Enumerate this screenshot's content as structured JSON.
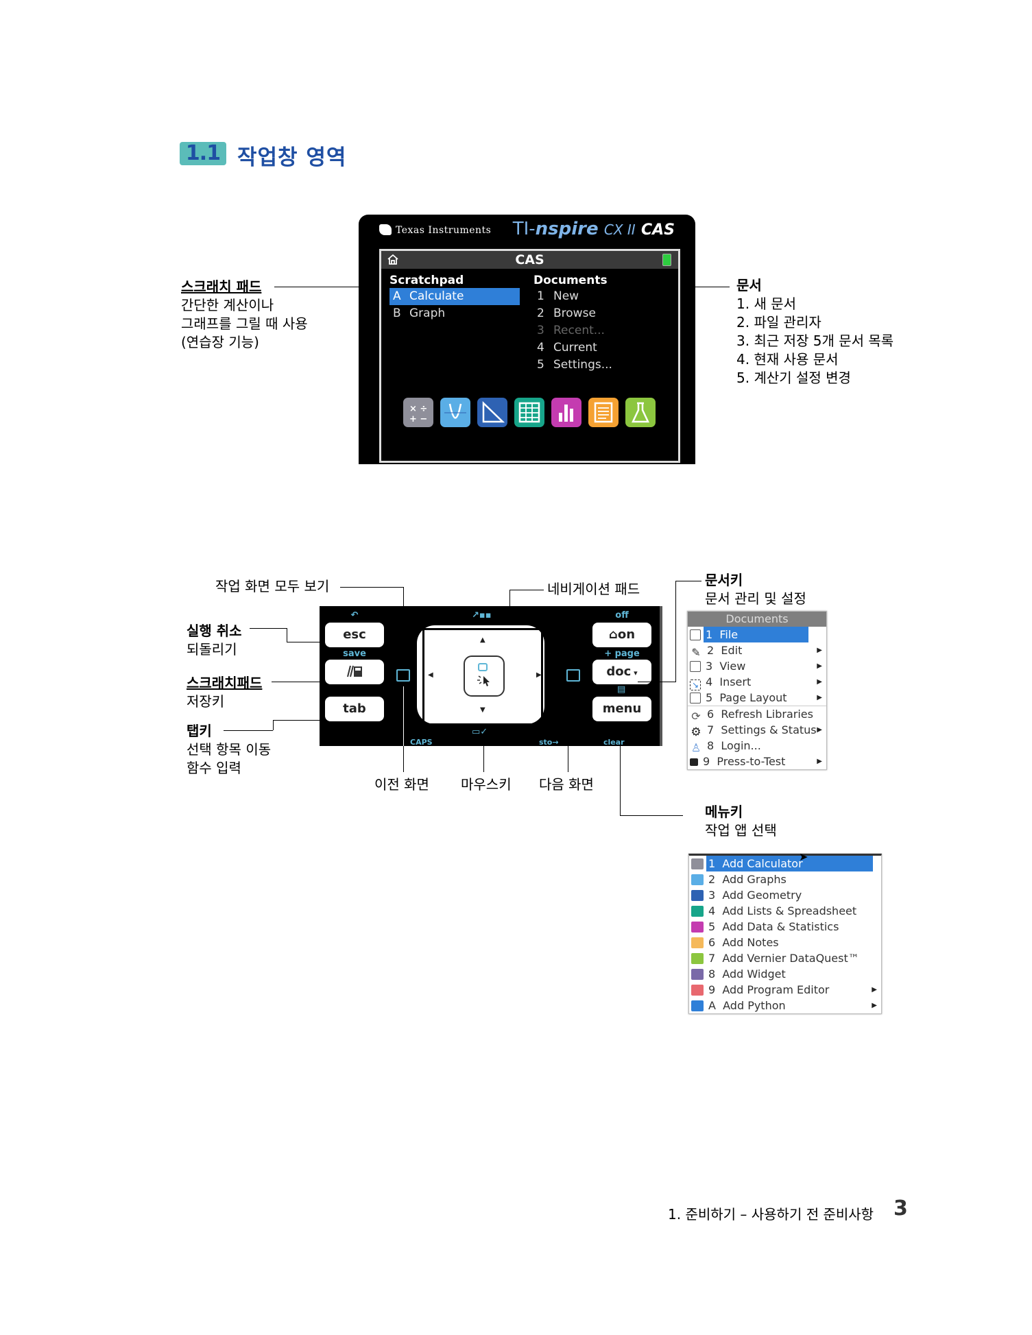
{
  "section": {
    "number": "1.1",
    "title": "작업창 영역"
  },
  "home_screen": {
    "brand": "Texas Instruments",
    "model_prefix": "TI-",
    "model_name": "nspire",
    "model_suffix": "CX II",
    "model_cas": "CAS",
    "header_title": "CAS",
    "scratchpad": {
      "heading": "Scratchpad",
      "items": [
        {
          "key": "A",
          "label": "Calculate",
          "selected": true
        },
        {
          "key": "B",
          "label": "Graph",
          "selected": false
        }
      ]
    },
    "documents": {
      "heading": "Documents",
      "items": [
        {
          "key": "1",
          "label": "New",
          "disabled": false
        },
        {
          "key": "2",
          "label": "Browse",
          "disabled": false
        },
        {
          "key": "3",
          "label": "Recent...",
          "disabled": true
        },
        {
          "key": "4",
          "label": "Current",
          "disabled": false
        },
        {
          "key": "5",
          "label": "Settings...",
          "disabled": false
        }
      ]
    },
    "app_icons": [
      {
        "name": "calculator-app-icon",
        "color": "#8f8f9a"
      },
      {
        "name": "graphs-app-icon",
        "color": "#5aaee6"
      },
      {
        "name": "geometry-app-icon",
        "color": "#2e62b3"
      },
      {
        "name": "lists-spreadsheet-app-icon",
        "color": "#17a58a"
      },
      {
        "name": "data-statistics-app-icon",
        "color": "#c43cb0"
      },
      {
        "name": "notes-app-icon",
        "color": "#f5a132"
      },
      {
        "name": "vernier-dataquest-app-icon",
        "color": "#8cc63f"
      }
    ]
  },
  "annotations_top": {
    "scratchpad": {
      "title": "스크래치 패드",
      "lines": [
        "간단한 계산이나",
        "그래프를 그릴 때 사용",
        "(연습장 기능)"
      ]
    },
    "documents": {
      "title": "문서",
      "lines": [
        "1. 새 문서",
        "2. 파일 관리자",
        "3. 최근 저장 5개 문서 목록",
        "4. 현재 사용 문서",
        "5. 계산기 설정 변경"
      ]
    }
  },
  "keypad": {
    "keys": {
      "esc": "esc",
      "scratchpad": "",
      "tab": "tab",
      "on": "on",
      "doc": "doc",
      "menu": "menu"
    },
    "sublabels": {
      "undo": "↶",
      "save": "save",
      "off": "off",
      "page": "+ page",
      "caps": "CAPS",
      "sto": "sto→",
      "clear": "clear"
    }
  },
  "annotations_bottom": {
    "view_all": "작업 화면 모두 보기",
    "nav_pad": "네비게이션 패드",
    "undo": {
      "title": "실행 취소",
      "line": "되돌리기"
    },
    "scratchpad_key": {
      "title": "스크래치패드",
      "line": "저장키"
    },
    "tab_key": {
      "title": "탭키",
      "lines": [
        "선택 항목 이동",
        "함수 입력"
      ]
    },
    "prev_page": "이전 화면",
    "mouse_key": "마우스키",
    "next_page": "다음 화면",
    "doc_key": {
      "title": "문서키",
      "line": "문서 관리 및 설정"
    },
    "menu_key": {
      "title": "메뉴키",
      "line": "작업 앱 선택"
    }
  },
  "documents_menu": {
    "title": "Documents",
    "items": [
      {
        "key": "1",
        "label": "File",
        "icon": "file-icon",
        "submenu": true,
        "selected": true
      },
      {
        "key": "2",
        "label": "Edit",
        "icon": "pencil-icon",
        "submenu": true
      },
      {
        "key": "3",
        "label": "View",
        "icon": "view-icon",
        "submenu": true
      },
      {
        "key": "4",
        "label": "Insert",
        "icon": "insert-icon",
        "submenu": true
      },
      {
        "key": "5",
        "label": "Page Layout",
        "icon": "page-layout-icon",
        "submenu": true
      },
      {
        "key": "6",
        "label": "Refresh Libraries",
        "icon": "refresh-icon",
        "submenu": false
      },
      {
        "key": "7",
        "label": "Settings & Status",
        "icon": "gear-icon",
        "submenu": true
      },
      {
        "key": "8",
        "label": "Login...",
        "icon": "user-icon",
        "submenu": false
      },
      {
        "key": "9",
        "label": "Press-to-Test",
        "icon": "lock-icon",
        "submenu": true
      }
    ]
  },
  "add_menu": {
    "items": [
      {
        "key": "1",
        "label": "Add Calculator",
        "icon": "calculator-icon",
        "color": "#8f8f9a",
        "submenu": false,
        "selected": true
      },
      {
        "key": "2",
        "label": "Add Graphs",
        "icon": "graphs-icon",
        "color": "#5aaee6",
        "submenu": false
      },
      {
        "key": "3",
        "label": "Add Geometry",
        "icon": "geometry-icon",
        "color": "#2e62b3",
        "submenu": false
      },
      {
        "key": "4",
        "label": "Add Lists & Spreadsheet",
        "icon": "spreadsheet-icon",
        "color": "#17a58a",
        "submenu": false
      },
      {
        "key": "5",
        "label": "Add Data & Statistics",
        "icon": "statistics-icon",
        "color": "#c43cb0",
        "submenu": false
      },
      {
        "key": "6",
        "label": "Add Notes",
        "icon": "notes-icon",
        "color": "#f5b95a",
        "submenu": false
      },
      {
        "key": "7",
        "label": "Add Vernier DataQuest™",
        "icon": "dataquest-icon",
        "color": "#8cc63f",
        "submenu": false
      },
      {
        "key": "8",
        "label": "Add Widget",
        "icon": "widget-icon",
        "color": "#7a6aa8",
        "submenu": false
      },
      {
        "key": "9",
        "label": "Add Program Editor",
        "icon": "program-editor-icon",
        "color": "#e8686f",
        "submenu": true
      },
      {
        "key": "A",
        "label": "Add Python",
        "icon": "python-icon",
        "color": "#2f7fd8",
        "submenu": true
      }
    ]
  },
  "footer": {
    "text": "1. 준비하기 – 사용하기 전 준비사항",
    "page": "3"
  }
}
